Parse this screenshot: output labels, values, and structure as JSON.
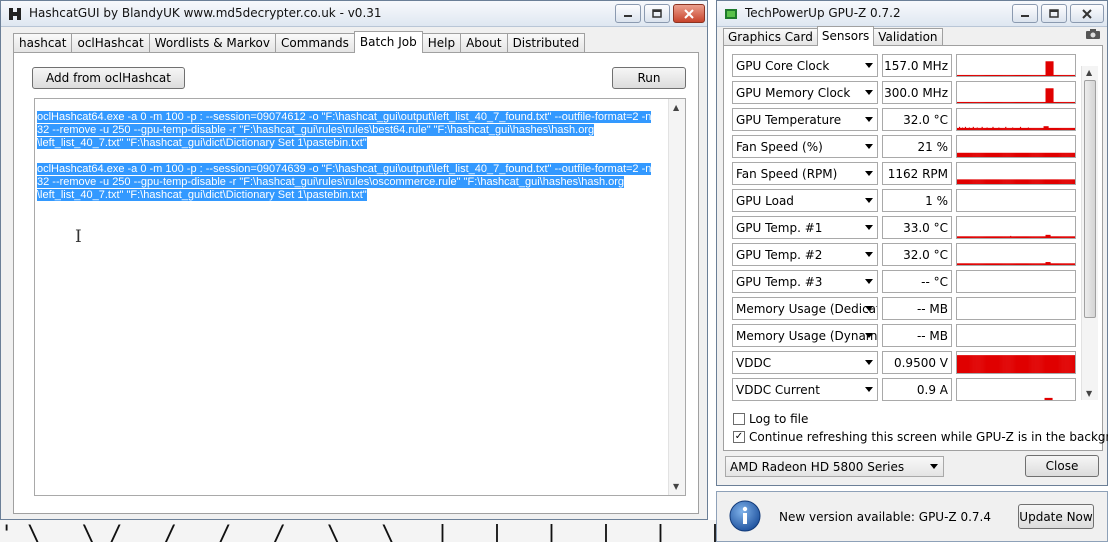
{
  "hashcat": {
    "title": "HashcatGUI by BlandyUK www.md5decrypter.co.uk - v0.31",
    "tabs": [
      "hashcat",
      "oclHashcat",
      "Wordlists & Markov",
      "Commands",
      "Batch Job",
      "Help",
      "About",
      "Distributed"
    ],
    "active_tab": "Batch Job",
    "add_button": "Add from oclHashcat",
    "run_button": "Run",
    "commands": [
      [
        "oclHashcat64.exe -a 0 -m 100 -p : --session=09074612 -o \"F:\\hashcat_gui\\output\\left_list_40_7_found.txt\" --outfile-format=2 -n",
        "32 --remove -u 250 --gpu-temp-disable -r \"F:\\hashcat_gui\\rules\\rules\\best64.rule\" \"F:\\hashcat_gui\\hashes\\hash.org",
        "\\left_list_40_7.txt\" \"F:\\hashcat_gui\\dict\\Dictionary Set 1\\pastebin.txt\""
      ],
      [
        "oclHashcat64.exe -a 0 -m 100 -p : --session=09074639 -o \"F:\\hashcat_gui\\output\\left_list_40_7_found.txt\" --outfile-format=2 -n",
        "32 --remove -u 250 --gpu-temp-disable -r \"F:\\hashcat_gui\\rules\\rules\\oscommerce.rule\" \"F:\\hashcat_gui\\hashes\\hash.org",
        "\\left_list_40_7.txt\" \"F:\\hashcat_gui\\dict\\Dictionary Set 1\\pastebin.txt\""
      ]
    ]
  },
  "gpuz": {
    "title": "TechPowerUp GPU-Z 0.7.2",
    "tabs": [
      "Graphics Card",
      "Sensors",
      "Validation"
    ],
    "active_tab": "Sensors",
    "sensors": [
      {
        "name": "GPU Core Clock",
        "value": "157.0 MHz",
        "graph": [
          0.05,
          0.05,
          0.05,
          0.05,
          0.05,
          0.05,
          0.05,
          0.05,
          0.05,
          0.05,
          0.05,
          0.05,
          0.05,
          0.05,
          0.05,
          0.05,
          0.05,
          0.05,
          0.05,
          0.05,
          0.05,
          0.05,
          0.05,
          0.05,
          0.05,
          0.05,
          0.05,
          0.05,
          0.05,
          0.05,
          0.05,
          0.05,
          0.05,
          0.05,
          0.05,
          0.05,
          0.05,
          0.05,
          0.05,
          0.05,
          0.05,
          0.05,
          0.05,
          0.05,
          0.05,
          0.05,
          0.05,
          0.05,
          0.05,
          0.05,
          0.05,
          0.05,
          0.05,
          0.05,
          0.05,
          0.05,
          0.05,
          0.05,
          0.05,
          0.05,
          0.05,
          0.05,
          0.05,
          0.05,
          0.05,
          0.05,
          0.05,
          0.05,
          0.05,
          0.05,
          0.05,
          0.05,
          0.05,
          0.05,
          0.05,
          0.05,
          0.05,
          0.05,
          0.05,
          0.05,
          0.05,
          0.05,
          0.05,
          0.05,
          0.05,
          0.05,
          0.05,
          0.05,
          0.05,
          0.05,
          0.7,
          0.7,
          0.7,
          0.7,
          0.7,
          0.7,
          0.7,
          0.7,
          0.05,
          0.05,
          0.05,
          0.05,
          0.05,
          0.05,
          0.05,
          0.05,
          0.05,
          0.05,
          0.05,
          0.05,
          0.05,
          0.05,
          0.05,
          0.05,
          0.05,
          0.05,
          0.05,
          0.05,
          0.05,
          0.05
        ]
      },
      {
        "name": "GPU Memory Clock",
        "value": "300.0 MHz",
        "graph": [
          0.05,
          0.05,
          0.05,
          0.05,
          0.05,
          0.05,
          0.05,
          0.05,
          0.05,
          0.05,
          0.05,
          0.05,
          0.05,
          0.05,
          0.05,
          0.05,
          0.05,
          0.05,
          0.05,
          0.05,
          0.05,
          0.05,
          0.05,
          0.05,
          0.05,
          0.05,
          0.05,
          0.05,
          0.05,
          0.05,
          0.05,
          0.05,
          0.05,
          0.05,
          0.05,
          0.05,
          0.05,
          0.05,
          0.05,
          0.05,
          0.05,
          0.05,
          0.05,
          0.05,
          0.05,
          0.05,
          0.05,
          0.05,
          0.05,
          0.05,
          0.05,
          0.05,
          0.05,
          0.05,
          0.05,
          0.05,
          0.05,
          0.05,
          0.05,
          0.05,
          0.05,
          0.05,
          0.05,
          0.05,
          0.05,
          0.05,
          0.05,
          0.05,
          0.05,
          0.05,
          0.05,
          0.05,
          0.05,
          0.05,
          0.05,
          0.05,
          0.05,
          0.05,
          0.05,
          0.05,
          0.05,
          0.05,
          0.05,
          0.05,
          0.05,
          0.05,
          0.05,
          0.05,
          0.05,
          0.05,
          0.7,
          0.7,
          0.7,
          0.7,
          0.7,
          0.7,
          0.7,
          0.7,
          0.05,
          0.05,
          0.05,
          0.05,
          0.05,
          0.05,
          0.05,
          0.05,
          0.05,
          0.05,
          0.05,
          0.05,
          0.05,
          0.05,
          0.05,
          0.05,
          0.05,
          0.05,
          0.05,
          0.05,
          0.05,
          0.05
        ]
      },
      {
        "name": "GPU Temperature",
        "value": "32.0 °C",
        "graph": [
          0.1,
          0.1,
          0.15,
          0.1,
          0.1,
          0.12,
          0.1,
          0.1,
          0.15,
          0.1,
          0.1,
          0.1,
          0.12,
          0.1,
          0.1,
          0.1,
          0.15,
          0.1,
          0.1,
          0.1,
          0.12,
          0.1,
          0.1,
          0.1,
          0.1,
          0.15,
          0.1,
          0.1,
          0.1,
          0.1,
          0.12,
          0.1,
          0.1,
          0.1,
          0.1,
          0.1,
          0.15,
          0.1,
          0.1,
          0.1,
          0.1,
          0.1,
          0.12,
          0.1,
          0.1,
          0.1,
          0.1,
          0.1,
          0.1,
          0.15,
          0.1,
          0.1,
          0.1,
          0.1,
          0.1,
          0.1,
          0.12,
          0.1,
          0.1,
          0.1,
          0.1,
          0.1,
          0.1,
          0.1,
          0.15,
          0.1,
          0.1,
          0.1,
          0.1,
          0.1,
          0.1,
          0.1,
          0.12,
          0.1,
          0.1,
          0.1,
          0.1,
          0.1,
          0.1,
          0.1,
          0.1,
          0.1,
          0.1,
          0.1,
          0.1,
          0.1,
          0.1,
          0.1,
          0.18,
          0.18,
          0.18,
          0.18,
          0.18,
          0.1,
          0.1,
          0.1,
          0.1,
          0.1,
          0.1,
          0.1,
          0.1,
          0.1,
          0.1,
          0.1,
          0.1,
          0.1,
          0.1,
          0.1,
          0.1,
          0.1,
          0.1,
          0.1,
          0.1,
          0.1,
          0.1,
          0.1,
          0.1,
          0.1,
          0.1,
          0.1
        ]
      },
      {
        "name": "Fan Speed (%)",
        "value": "21 %",
        "graph": [
          0.2,
          0.2,
          0.2,
          0.2,
          0.2,
          0.2,
          0.2,
          0.2,
          0.2,
          0.2,
          0.2,
          0.2,
          0.2,
          0.2,
          0.2,
          0.2,
          0.2,
          0.2,
          0.2,
          0.2,
          0.2,
          0.2,
          0.2,
          0.2,
          0.2,
          0.2,
          0.2,
          0.2,
          0.2,
          0.2,
          0.2,
          0.2,
          0.2,
          0.2,
          0.2,
          0.2,
          0.2,
          0.2,
          0.2,
          0.2,
          0.2,
          0.2,
          0.2,
          0.2,
          0.2,
          0.2,
          0.2,
          0.2,
          0.2,
          0.2,
          0.2,
          0.2,
          0.2,
          0.2,
          0.2,
          0.2,
          0.2,
          0.2,
          0.2,
          0.2,
          0.2,
          0.2,
          0.2,
          0.2,
          0.2,
          0.2,
          0.2,
          0.2,
          0.2,
          0.2,
          0.2,
          0.2,
          0.2,
          0.2,
          0.2,
          0.2,
          0.2,
          0.2,
          0.2,
          0.2,
          0.2,
          0.2,
          0.2,
          0.2,
          0.2,
          0.2,
          0.2,
          0.2,
          0.2,
          0.2,
          0.2,
          0.2,
          0.2,
          0.2,
          0.2,
          0.2,
          0.2,
          0.2,
          0.2,
          0.2,
          0.2,
          0.2,
          0.2,
          0.2,
          0.2,
          0.2,
          0.2,
          0.2,
          0.2,
          0.2,
          0.2,
          0.2,
          0.2,
          0.2,
          0.2,
          0.2,
          0.2,
          0.2,
          0.2,
          0.2
        ]
      },
      {
        "name": "Fan Speed (RPM)",
        "value": "1162 RPM",
        "graph": [
          0.22,
          0.22,
          0.22,
          0.22,
          0.22,
          0.22,
          0.22,
          0.22,
          0.22,
          0.22,
          0.22,
          0.22,
          0.22,
          0.22,
          0.22,
          0.22,
          0.22,
          0.22,
          0.22,
          0.22,
          0.22,
          0.22,
          0.22,
          0.22,
          0.22,
          0.22,
          0.22,
          0.22,
          0.22,
          0.22,
          0.22,
          0.22,
          0.22,
          0.22,
          0.22,
          0.22,
          0.22,
          0.22,
          0.22,
          0.22,
          0.22,
          0.22,
          0.22,
          0.22,
          0.22,
          0.22,
          0.22,
          0.22,
          0.22,
          0.22,
          0.22,
          0.22,
          0.22,
          0.22,
          0.22,
          0.22,
          0.22,
          0.22,
          0.22,
          0.22,
          0.22,
          0.22,
          0.22,
          0.22,
          0.22,
          0.22,
          0.22,
          0.22,
          0.22,
          0.22,
          0.22,
          0.22,
          0.22,
          0.22,
          0.22,
          0.22,
          0.22,
          0.22,
          0.22,
          0.22,
          0.22,
          0.22,
          0.22,
          0.22,
          0.22,
          0.22,
          0.22,
          0.22,
          0.22,
          0.22,
          0.22,
          0.22,
          0.22,
          0.22,
          0.22,
          0.22,
          0.22,
          0.22,
          0.22,
          0.22,
          0.22,
          0.22,
          0.22,
          0.22,
          0.22,
          0.22,
          0.22,
          0.22,
          0.22,
          0.22,
          0.22,
          0.22,
          0.22,
          0.22,
          0.22,
          0.22,
          0.22,
          0.22,
          0.22,
          0.22
        ]
      },
      {
        "name": "GPU Load",
        "value": "1 %",
        "graph": []
      },
      {
        "name": "GPU Temp. #1",
        "value": "33.0 °C",
        "graph": [
          0.08,
          0.08,
          0.08,
          0.08,
          0.08,
          0.08,
          0.08,
          0.08,
          0.08,
          0.08,
          0.08,
          0.08,
          0.08,
          0.08,
          0.08,
          0.08,
          0.08,
          0.08,
          0.08,
          0.08,
          0.08,
          0.08,
          0.08,
          0.08,
          0.08,
          0.08,
          0.08,
          0.08,
          0.08,
          0.08,
          0.08,
          0.08,
          0.08,
          0.08,
          0.08,
          0.08,
          0.08,
          0.08,
          0.08,
          0.08,
          0.08,
          0.08,
          0.08,
          0.08,
          0.08,
          0.08,
          0.08,
          0.08,
          0.08,
          0.08,
          0.08,
          0.08,
          0.08,
          0.08,
          0.1,
          0.08,
          0.08,
          0.08,
          0.08,
          0.08,
          0.08,
          0.08,
          0.08,
          0.08,
          0.08,
          0.08,
          0.08,
          0.08,
          0.08,
          0.08,
          0.08,
          0.08,
          0.08,
          0.08,
          0.08,
          0.08,
          0.08,
          0.08,
          0.08,
          0.08,
          0.08,
          0.08,
          0.08,
          0.08,
          0.08,
          0.08,
          0.08,
          0.08,
          0.08,
          0.08,
          0.15,
          0.15,
          0.15,
          0.15,
          0.15,
          0.08,
          0.08,
          0.08,
          0.08,
          0.08,
          0.08,
          0.08,
          0.08,
          0.08,
          0.08,
          0.08,
          0.08,
          0.08,
          0.08,
          0.08,
          0.08,
          0.08,
          0.08,
          0.08,
          0.08,
          0.08,
          0.08,
          0.08,
          0.08,
          0.08
        ]
      },
      {
        "name": "GPU Temp. #2",
        "value": "32.0 °C",
        "graph": [
          0.08,
          0.08,
          0.08,
          0.08,
          0.08,
          0.08,
          0.08,
          0.08,
          0.08,
          0.08,
          0.08,
          0.08,
          0.08,
          0.08,
          0.08,
          0.08,
          0.08,
          0.08,
          0.08,
          0.08,
          0.08,
          0.08,
          0.08,
          0.08,
          0.08,
          0.08,
          0.08,
          0.08,
          0.08,
          0.08,
          0.08,
          0.08,
          0.08,
          0.08,
          0.08,
          0.08,
          0.08,
          0.08,
          0.08,
          0.08,
          0.08,
          0.08,
          0.08,
          0.08,
          0.08,
          0.08,
          0.08,
          0.08,
          0.08,
          0.08,
          0.08,
          0.08,
          0.08,
          0.08,
          0.08,
          0.08,
          0.08,
          0.08,
          0.08,
          0.08,
          0.08,
          0.08,
          0.08,
          0.08,
          0.08,
          0.08,
          0.08,
          0.08,
          0.08,
          0.08,
          0.08,
          0.08,
          0.08,
          0.08,
          0.08,
          0.08,
          0.08,
          0.08,
          0.08,
          0.08,
          0.08,
          0.08,
          0.08,
          0.08,
          0.08,
          0.08,
          0.08,
          0.08,
          0.08,
          0.08,
          0.14,
          0.14,
          0.14,
          0.14,
          0.14,
          0.08,
          0.08,
          0.08,
          0.08,
          0.08,
          0.08,
          0.08,
          0.08,
          0.08,
          0.08,
          0.08,
          0.08,
          0.08,
          0.08,
          0.08,
          0.08,
          0.08,
          0.08,
          0.08,
          0.08,
          0.08,
          0.08,
          0.08,
          0.08,
          0.08
        ]
      },
      {
        "name": "GPU Temp. #3",
        "value": "-- °C",
        "graph": []
      },
      {
        "name": "Memory Usage (Dedicated)",
        "value": "-- MB",
        "graph": []
      },
      {
        "name": "Memory Usage (Dynamic)",
        "value": "-- MB",
        "graph": []
      },
      {
        "name": "VDDC",
        "value": "0.9500 V",
        "graph": [
          0.85,
          0.85,
          0.85,
          0.85,
          0.85,
          0.85,
          0.85,
          0.85,
          0.85,
          0.85,
          0.85,
          0.85,
          0.85,
          0.85,
          0.85,
          0.85,
          0.85,
          0.85,
          0.85,
          0.85,
          0.85,
          0.85,
          0.85,
          0.85,
          0.85,
          0.85,
          0.85,
          0.85,
          0.85,
          0.85,
          0.85,
          0.85,
          0.85,
          0.85,
          0.85,
          0.85,
          0.85,
          0.85,
          0.85,
          0.85,
          0.85,
          0.85,
          0.85,
          0.85,
          0.85,
          0.85,
          0.85,
          0.85,
          0.85,
          0.85,
          0.85,
          0.85,
          0.85,
          0.85,
          0.85,
          0.85,
          0.85,
          0.85,
          0.85,
          0.85,
          0.85,
          0.85,
          0.85,
          0.85,
          0.85,
          0.85,
          0.85,
          0.85,
          0.85,
          0.85,
          0.85,
          0.85,
          0.85,
          0.85,
          0.85,
          0.85,
          0.85,
          0.85,
          0.85,
          0.85,
          0.85,
          0.85,
          0.85,
          0.85,
          0.85,
          0.85,
          0.85,
          0.85,
          0.85,
          0.85,
          0.85,
          0.85,
          0.85,
          0.85,
          0.85,
          0.85,
          0.85,
          0.85,
          0.85,
          0.85,
          0.85,
          0.85,
          0.85,
          0.85,
          0.85,
          0.85,
          0.85,
          0.85,
          0.85,
          0.85,
          0.85,
          0.85,
          0.85,
          0.85,
          0.85,
          0.85,
          0.85,
          0.85,
          0.85,
          0.85
        ]
      },
      {
        "name": "VDDC Current",
        "value": "0.9 A",
        "graph": [
          0,
          0,
          0,
          0,
          0,
          0,
          0,
          0,
          0,
          0,
          0,
          0,
          0,
          0,
          0,
          0,
          0,
          0,
          0,
          0,
          0,
          0,
          0,
          0,
          0,
          0,
          0,
          0,
          0,
          0,
          0,
          0,
          0,
          0,
          0,
          0,
          0,
          0,
          0,
          0,
          0,
          0,
          0,
          0,
          0,
          0,
          0,
          0,
          0,
          0,
          0,
          0,
          0,
          0,
          0,
          0,
          0,
          0,
          0,
          0,
          0,
          0,
          0,
          0,
          0,
          0,
          0,
          0,
          0,
          0,
          0,
          0,
          0,
          0,
          0,
          0,
          0,
          0,
          0,
          0,
          0,
          0,
          0,
          0,
          0,
          0,
          0,
          0,
          0,
          0.1,
          0.1,
          0.1,
          0.1,
          0.1,
          0.1,
          0.1,
          0.1,
          0,
          0,
          0,
          0,
          0,
          0,
          0,
          0,
          0,
          0,
          0,
          0,
          0,
          0,
          0,
          0,
          0,
          0,
          0,
          0,
          0,
          0,
          0
        ]
      }
    ],
    "log_to_file": {
      "label": "Log to file",
      "checked": false
    },
    "continue_refreshing": {
      "label": "Continue refreshing this screen while GPU-Z is in the background",
      "checked": true
    },
    "gpu_selected": "AMD Radeon HD 5800 Series",
    "close_button": "Close"
  },
  "update": {
    "message": "New version available: GPU-Z 0.7.4",
    "button": "Update Now"
  },
  "colors": {
    "selection": "#3399ff",
    "graph": "#e00000",
    "titlebar": "#dfe7f1"
  },
  "desktop": {
    "strip_glyphs": "'\\  \\/ /  /  /_\\  \\ |  |  |  |  |  |  /  /  /"
  }
}
